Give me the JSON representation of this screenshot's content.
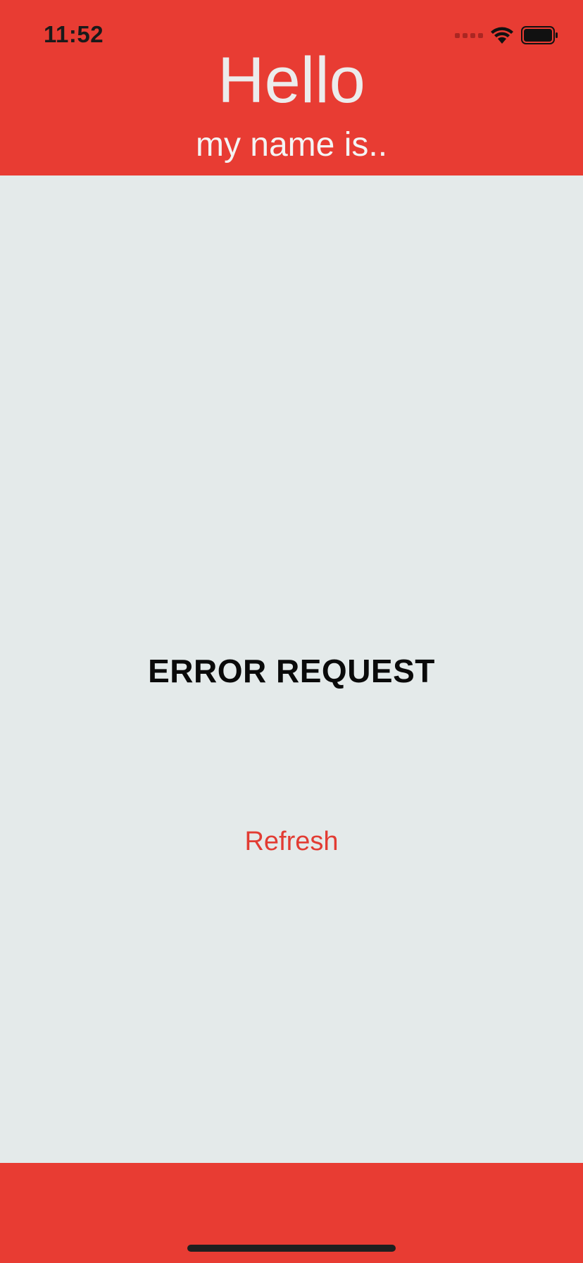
{
  "status_bar": {
    "time": "11:52",
    "icons": [
      "cellular-signal-icon",
      "wifi-icon",
      "battery-icon"
    ]
  },
  "header": {
    "title": "Hello",
    "subtitle": "my name is.."
  },
  "main": {
    "error_message": "ERROR REQUEST",
    "refresh_label": "Refresh"
  },
  "colors": {
    "accent": "#E83C33",
    "background": "#E4EAEA",
    "refresh_text": "#E23C33"
  }
}
